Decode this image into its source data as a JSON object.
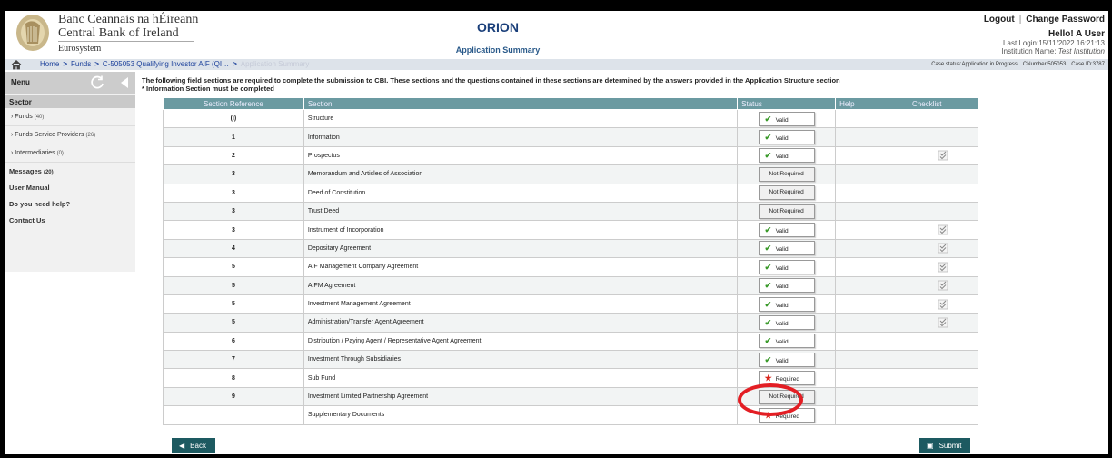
{
  "header": {
    "bank_name_ga": "Banc Ceannais na hÉireann",
    "bank_name_en": "Central Bank of Ireland",
    "eurosystem": "Eurosystem",
    "app_name": "ORION",
    "page_title": "Application Summary",
    "logout": "Logout",
    "change_password": "Change Password",
    "greeting": "Hello! A User",
    "last_login": "Last Login:15/11/2022 16:21:13",
    "institution_label": "Institution Name:",
    "institution_name": "Test Institution"
  },
  "breadcrumb": {
    "items": [
      "Home",
      "Funds",
      "C-505053 Qualifying Investor AIF (QI…",
      "Application Summary"
    ],
    "case_status": "Case status:Application in Progress",
    "cl_number": "CNumber:505053",
    "case_id": "Case ID:3787"
  },
  "sidebar": {
    "menu_label": "Menu",
    "sector_label": "Sector",
    "items": [
      {
        "label": "Funds",
        "count": "(40)"
      },
      {
        "label": "Funds Service Providers",
        "count": "(26)"
      },
      {
        "label": "Intermediaries",
        "count": "(0)"
      }
    ],
    "links": [
      {
        "label": "Messages",
        "count": "(20)"
      },
      {
        "label": "User Manual",
        "count": ""
      },
      {
        "label": "Do you need help?",
        "count": ""
      },
      {
        "label": "Contact Us",
        "count": ""
      }
    ]
  },
  "intro": {
    "text": "The following field sections are required to complete the submission to CBI. These sections and the questions contained in these sections are determined by the answers provided in the Application Structure section",
    "note": "* Information Section must be completed"
  },
  "table": {
    "headers": [
      "Section Reference",
      "Section",
      "Status",
      "Help",
      "Checklist"
    ],
    "rows": [
      {
        "ref": "(i)",
        "section": "Structure",
        "status": "Valid",
        "checklist": false
      },
      {
        "ref": "1",
        "section": "Information",
        "status": "Valid",
        "checklist": false
      },
      {
        "ref": "2",
        "section": "Prospectus",
        "status": "Valid",
        "checklist": true
      },
      {
        "ref": "3",
        "section": "Memorandum and Articles of Association",
        "status": "Not Required",
        "checklist": false
      },
      {
        "ref": "3",
        "section": "Deed of Constitution",
        "status": "Not Required",
        "checklist": false
      },
      {
        "ref": "3",
        "section": "Trust Deed",
        "status": "Not Required",
        "checklist": false
      },
      {
        "ref": "3",
        "section": "Instrument of Incorporation",
        "status": "Valid",
        "checklist": true
      },
      {
        "ref": "4",
        "section": "Depositary Agreement",
        "status": "Valid",
        "checklist": true
      },
      {
        "ref": "5",
        "section": "AIF Management Company Agreement",
        "status": "Valid",
        "checklist": true
      },
      {
        "ref": "5",
        "section": "AIFM Agreement",
        "status": "Valid",
        "checklist": true
      },
      {
        "ref": "5",
        "section": "Investment Management Agreement",
        "status": "Valid",
        "checklist": true
      },
      {
        "ref": "5",
        "section": "Administration/Transfer Agent Agreement",
        "status": "Valid",
        "checklist": true
      },
      {
        "ref": "6",
        "section": "Distribution / Paying Agent / Representative Agent Agreement",
        "status": "Valid",
        "checklist": false
      },
      {
        "ref": "7",
        "section": "Investment Through Subsidiaries",
        "status": "Valid",
        "checklist": false
      },
      {
        "ref": "8",
        "section": "Sub Fund",
        "status": "Required",
        "checklist": false
      },
      {
        "ref": "9",
        "section": "Investment Limited Partnership Agreement",
        "status": "Not Required",
        "checklist": false
      },
      {
        "ref": "",
        "section": "Supplementary Documents",
        "status": "Required",
        "checklist": false
      }
    ]
  },
  "actions": {
    "back": "Back",
    "submit": "Submit"
  },
  "colors": {
    "header_accent": "#1a3f7a",
    "table_header": "#6b9aa1",
    "button": "#1d5a61",
    "valid": "#3a9a2a",
    "required": "#d9251c",
    "highlight": "#e31e24"
  }
}
